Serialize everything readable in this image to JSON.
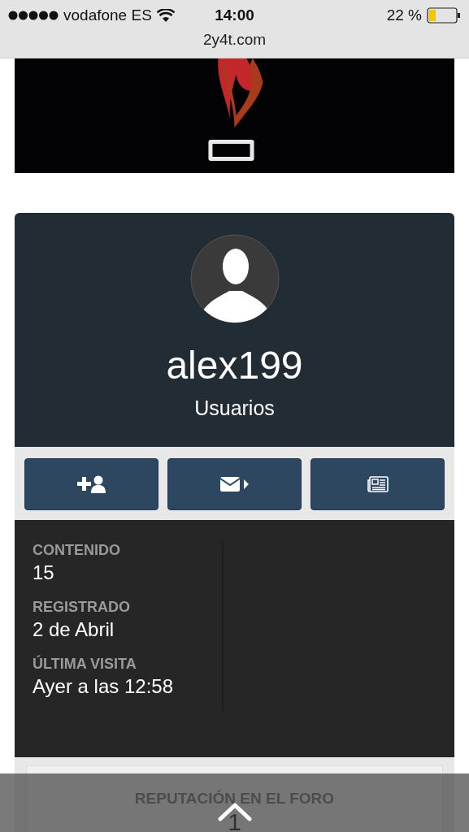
{
  "status_bar": {
    "carrier": "vodafone ES",
    "time": "14:00",
    "battery": "22 %"
  },
  "address_bar": {
    "url": "2y4t.com"
  },
  "profile": {
    "username": "alex199",
    "group": "Usuarios"
  },
  "actions": [
    {
      "kind": "add-friend"
    },
    {
      "kind": "message"
    },
    {
      "kind": "news"
    }
  ],
  "stats": [
    {
      "label": "CONTENIDO",
      "value": "15"
    },
    {
      "label": "REGISTRADO",
      "value": "2 de Abril"
    },
    {
      "label": "ÚLTIMA VISITA",
      "value": "Ayer a las 12:58"
    }
  ],
  "reputation": {
    "title": "REPUTACIÓN EN EL FORO",
    "value": "1"
  }
}
